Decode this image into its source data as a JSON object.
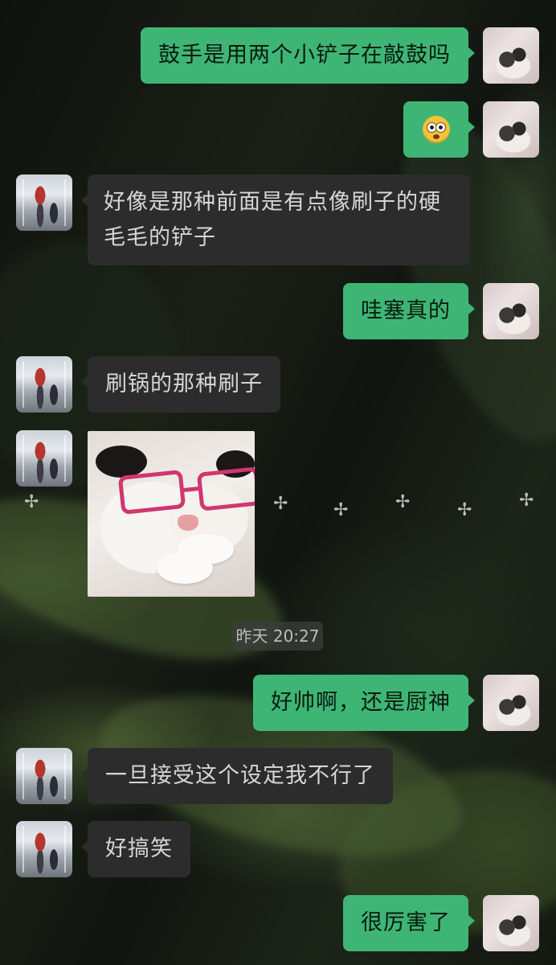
{
  "timestamp": "昨天 20:27",
  "colors": {
    "my_bubble": "#3eb575",
    "friend_bubble": "#2c2c2c",
    "glasses": "#d0366f"
  },
  "messages": [
    {
      "sender": "me",
      "type": "text",
      "text": "鼓手是用两个小铲子在敲鼓吗"
    },
    {
      "sender": "me",
      "type": "emoji",
      "emoji": "flushed-face-emoji"
    },
    {
      "sender": "friend",
      "type": "text",
      "text": "好像是那种前面是有点像刷子的硬毛毛的铲子"
    },
    {
      "sender": "me",
      "type": "text",
      "text": "哇塞真的"
    },
    {
      "sender": "friend",
      "type": "text",
      "text": "刷锅的那种刷子"
    },
    {
      "sender": "friend",
      "type": "sticker",
      "sticker": "cat-with-pink-glasses-sticker"
    },
    {
      "sender": "me",
      "type": "text",
      "text": "好帅啊，还是厨神"
    },
    {
      "sender": "friend",
      "type": "text",
      "text": "一旦接受这个设定我不行了"
    },
    {
      "sender": "friend",
      "type": "text",
      "text": "好搞笑"
    },
    {
      "sender": "me",
      "type": "text",
      "text": "很厉害了"
    }
  ]
}
